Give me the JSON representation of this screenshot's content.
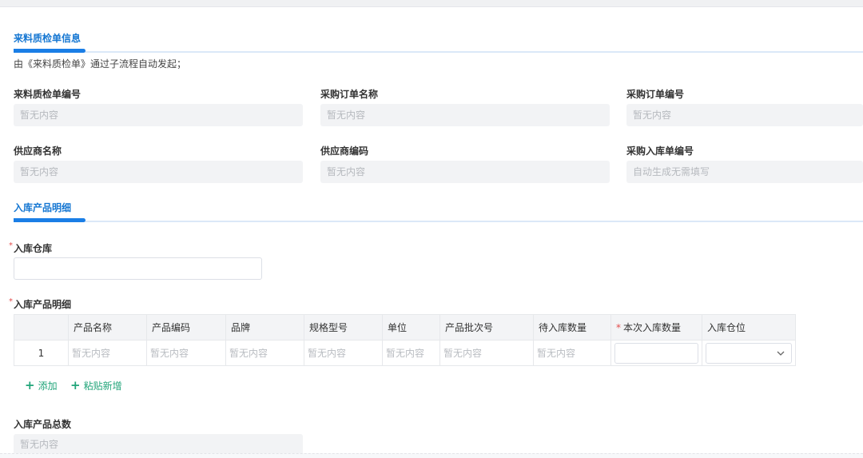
{
  "section1": {
    "title": "来料质检单信息",
    "note": "由《来料质检单》通过子流程自动发起；",
    "fields": [
      {
        "label": "来料质检单编号",
        "value": "暂无内容"
      },
      {
        "label": "采购订单名称",
        "value": "暂无内容"
      },
      {
        "label": "采购订单编号",
        "value": "暂无内容"
      },
      {
        "label": "供应商名称",
        "value": "暂无内容"
      },
      {
        "label": "供应商编码",
        "value": "暂无内容"
      },
      {
        "label": "采购入库单编号",
        "value": "自动生成无需填写"
      }
    ]
  },
  "section2": {
    "title": "入库产品明细",
    "warehouse": {
      "required_mark": "*",
      "label": "入库仓库",
      "value": ""
    },
    "detail_label": "入库产品明细",
    "table": {
      "headers": [
        "",
        "产品名称",
        "产品编码",
        "品牌",
        "规格型号",
        "单位",
        "产品批次号",
        "待入库数量",
        "本次入库数量",
        "入库仓位"
      ],
      "required_header_mark": "*",
      "rows": [
        {
          "index": "1",
          "cells": [
            "暂无内容",
            "暂无内容",
            "暂无内容",
            "暂无内容",
            "暂无内容",
            "暂无内容",
            "暂无内容"
          ],
          "qty_value": "",
          "location_value": ""
        }
      ]
    },
    "actions": {
      "add": "添加",
      "paste_add": "粘贴新增"
    },
    "total": {
      "label": "入库产品总数",
      "value": "暂无内容"
    }
  },
  "icons": {
    "add": "plus-icon",
    "paste": "plus-icon",
    "dropdown": "chevron-down-icon"
  }
}
